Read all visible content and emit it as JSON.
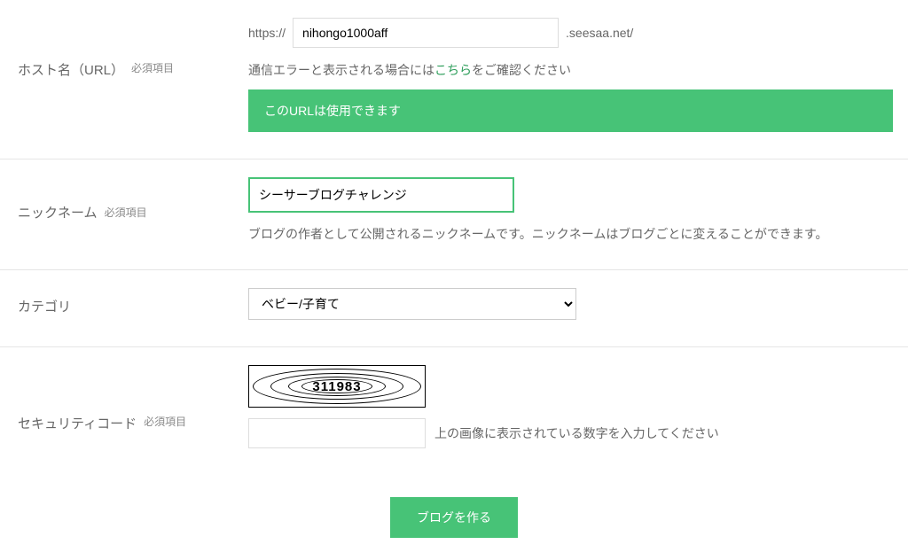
{
  "urlRow": {
    "label": "ホスト名（URL）",
    "required": "必須項目",
    "prefix": "https://",
    "value": "nihongo1000aff",
    "suffix": ".seesaa.net/",
    "hint_before": "通信エラーと表示される場合には",
    "hint_link": "こちら",
    "hint_after": "をご確認ください",
    "success": "このURLは使用できます"
  },
  "nicknameRow": {
    "label": "ニックネーム",
    "required": "必須項目",
    "value": "シーサーブログチャレンジ",
    "hint": "ブログの作者として公開されるニックネームです。ニックネームはブログごとに変えることができます。"
  },
  "categoryRow": {
    "label": "カテゴリ",
    "selected": "ベビー/子育て"
  },
  "securityRow": {
    "label": "セキュリティコード",
    "required": "必須項目",
    "captcha": "311983",
    "hint": "上の画像に表示されている数字を入力してください"
  },
  "submit": {
    "label": "ブログを作る"
  }
}
